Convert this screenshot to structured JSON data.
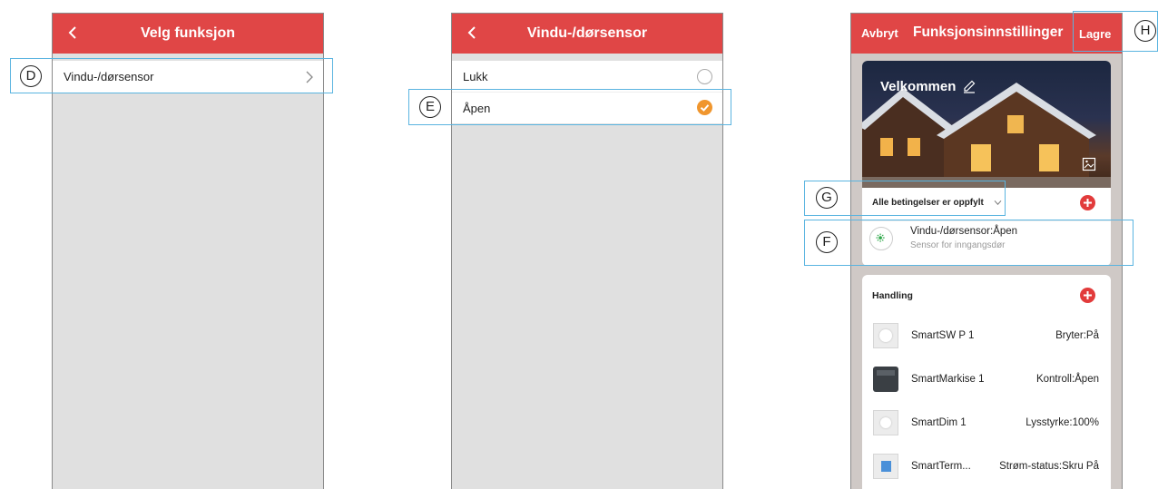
{
  "screen1": {
    "title": "Velg funksjon",
    "items": [
      {
        "label": "Vindu-/dørsensor"
      }
    ],
    "callout_letter": "D"
  },
  "screen2": {
    "title": "Vindu-/dørsensor",
    "options": [
      {
        "label": "Lukk",
        "selected": false
      },
      {
        "label": "Åpen",
        "selected": true
      }
    ],
    "callout_letter": "E"
  },
  "screen3": {
    "cancel_label": "Avbryt",
    "title": "Funksjonsinnstillinger",
    "save_label": "Lagre",
    "banner_title": "Velkommen",
    "conditions": {
      "heading": "Alle betingelser er oppfylt",
      "item_title": "Vindu-/dørsensor:Åpen",
      "item_subtitle": "Sensor for inngangsdør"
    },
    "actions": {
      "heading": "Handling",
      "items": [
        {
          "name": "SmartSW P 1",
          "value": "Bryter:På",
          "icon": "switch-device-icon"
        },
        {
          "name": "SmartMarkise 1",
          "value": "Kontroll:Åpen",
          "icon": "awning-controller-icon"
        },
        {
          "name": "SmartDim 1",
          "value": "Lysstyrke:100%",
          "icon": "dimmer-device-icon"
        },
        {
          "name": "SmartTerm...",
          "value": "Strøm-status:Skru På",
          "icon": "thermostat-device-icon"
        }
      ]
    },
    "callout_letters": {
      "conditions": "G",
      "condition_item": "F",
      "save": "H"
    }
  },
  "colors": {
    "header": "#e04646",
    "accent_orange": "#f0962e",
    "callout": "#5ab4e0",
    "add_red": "#e23b3b"
  }
}
